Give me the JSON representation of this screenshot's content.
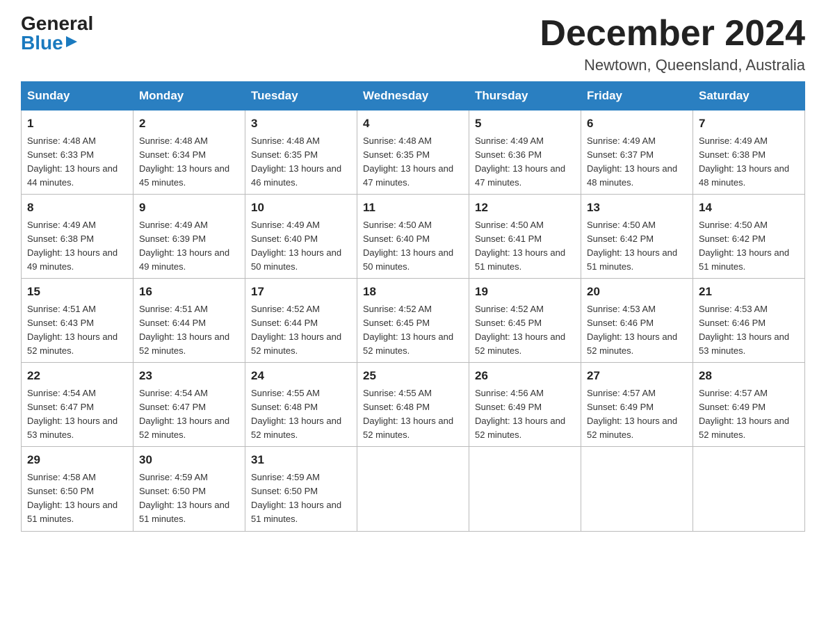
{
  "header": {
    "logo_general": "General",
    "logo_blue": "Blue",
    "month_title": "December 2024",
    "location": "Newtown, Queensland, Australia"
  },
  "weekdays": [
    "Sunday",
    "Monday",
    "Tuesday",
    "Wednesday",
    "Thursday",
    "Friday",
    "Saturday"
  ],
  "weeks": [
    [
      {
        "day": "1",
        "sunrise": "4:48 AM",
        "sunset": "6:33 PM",
        "daylight": "13 hours and 44 minutes."
      },
      {
        "day": "2",
        "sunrise": "4:48 AM",
        "sunset": "6:34 PM",
        "daylight": "13 hours and 45 minutes."
      },
      {
        "day": "3",
        "sunrise": "4:48 AM",
        "sunset": "6:35 PM",
        "daylight": "13 hours and 46 minutes."
      },
      {
        "day": "4",
        "sunrise": "4:48 AM",
        "sunset": "6:35 PM",
        "daylight": "13 hours and 47 minutes."
      },
      {
        "day": "5",
        "sunrise": "4:49 AM",
        "sunset": "6:36 PM",
        "daylight": "13 hours and 47 minutes."
      },
      {
        "day": "6",
        "sunrise": "4:49 AM",
        "sunset": "6:37 PM",
        "daylight": "13 hours and 48 minutes."
      },
      {
        "day": "7",
        "sunrise": "4:49 AM",
        "sunset": "6:38 PM",
        "daylight": "13 hours and 48 minutes."
      }
    ],
    [
      {
        "day": "8",
        "sunrise": "4:49 AM",
        "sunset": "6:38 PM",
        "daylight": "13 hours and 49 minutes."
      },
      {
        "day": "9",
        "sunrise": "4:49 AM",
        "sunset": "6:39 PM",
        "daylight": "13 hours and 49 minutes."
      },
      {
        "day": "10",
        "sunrise": "4:49 AM",
        "sunset": "6:40 PM",
        "daylight": "13 hours and 50 minutes."
      },
      {
        "day": "11",
        "sunrise": "4:50 AM",
        "sunset": "6:40 PM",
        "daylight": "13 hours and 50 minutes."
      },
      {
        "day": "12",
        "sunrise": "4:50 AM",
        "sunset": "6:41 PM",
        "daylight": "13 hours and 51 minutes."
      },
      {
        "day": "13",
        "sunrise": "4:50 AM",
        "sunset": "6:42 PM",
        "daylight": "13 hours and 51 minutes."
      },
      {
        "day": "14",
        "sunrise": "4:50 AM",
        "sunset": "6:42 PM",
        "daylight": "13 hours and 51 minutes."
      }
    ],
    [
      {
        "day": "15",
        "sunrise": "4:51 AM",
        "sunset": "6:43 PM",
        "daylight": "13 hours and 52 minutes."
      },
      {
        "day": "16",
        "sunrise": "4:51 AM",
        "sunset": "6:44 PM",
        "daylight": "13 hours and 52 minutes."
      },
      {
        "day": "17",
        "sunrise": "4:52 AM",
        "sunset": "6:44 PM",
        "daylight": "13 hours and 52 minutes."
      },
      {
        "day": "18",
        "sunrise": "4:52 AM",
        "sunset": "6:45 PM",
        "daylight": "13 hours and 52 minutes."
      },
      {
        "day": "19",
        "sunrise": "4:52 AM",
        "sunset": "6:45 PM",
        "daylight": "13 hours and 52 minutes."
      },
      {
        "day": "20",
        "sunrise": "4:53 AM",
        "sunset": "6:46 PM",
        "daylight": "13 hours and 52 minutes."
      },
      {
        "day": "21",
        "sunrise": "4:53 AM",
        "sunset": "6:46 PM",
        "daylight": "13 hours and 53 minutes."
      }
    ],
    [
      {
        "day": "22",
        "sunrise": "4:54 AM",
        "sunset": "6:47 PM",
        "daylight": "13 hours and 53 minutes."
      },
      {
        "day": "23",
        "sunrise": "4:54 AM",
        "sunset": "6:47 PM",
        "daylight": "13 hours and 52 minutes."
      },
      {
        "day": "24",
        "sunrise": "4:55 AM",
        "sunset": "6:48 PM",
        "daylight": "13 hours and 52 minutes."
      },
      {
        "day": "25",
        "sunrise": "4:55 AM",
        "sunset": "6:48 PM",
        "daylight": "13 hours and 52 minutes."
      },
      {
        "day": "26",
        "sunrise": "4:56 AM",
        "sunset": "6:49 PM",
        "daylight": "13 hours and 52 minutes."
      },
      {
        "day": "27",
        "sunrise": "4:57 AM",
        "sunset": "6:49 PM",
        "daylight": "13 hours and 52 minutes."
      },
      {
        "day": "28",
        "sunrise": "4:57 AM",
        "sunset": "6:49 PM",
        "daylight": "13 hours and 52 minutes."
      }
    ],
    [
      {
        "day": "29",
        "sunrise": "4:58 AM",
        "sunset": "6:50 PM",
        "daylight": "13 hours and 51 minutes."
      },
      {
        "day": "30",
        "sunrise": "4:59 AM",
        "sunset": "6:50 PM",
        "daylight": "13 hours and 51 minutes."
      },
      {
        "day": "31",
        "sunrise": "4:59 AM",
        "sunset": "6:50 PM",
        "daylight": "13 hours and 51 minutes."
      },
      null,
      null,
      null,
      null
    ]
  ]
}
